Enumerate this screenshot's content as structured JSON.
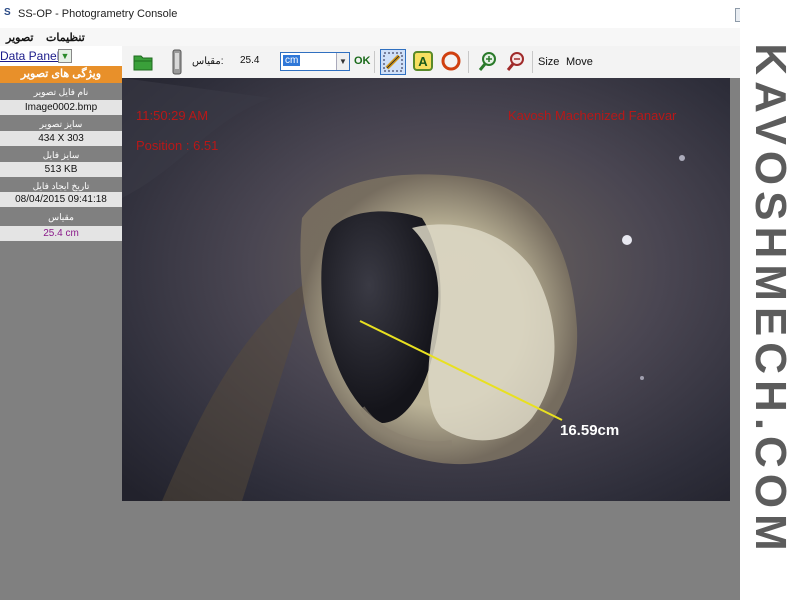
{
  "window": {
    "title": "SS-OP - Photogrametry Console",
    "icon": "ss-logo-icon",
    "controls": [
      "minimize-icon",
      "maximize-icon",
      "close-icon"
    ]
  },
  "menu": {
    "items": [
      "تصوير",
      "تنظيمات"
    ]
  },
  "toolbar": {
    "open_icon": "folder-icon",
    "device_icon": "camera-icon",
    "scale_label": "مقياس:",
    "scale_value": "25.4",
    "unit_value": "cm",
    "ok_label": "OK",
    "ruler_icon": "ruler-icon",
    "text_icon": "text-a-icon",
    "circle_icon": "circle-icon",
    "zoom_in_icon": "zoom-in-icon",
    "zoom_out_icon": "zoom-out-icon",
    "size_label": "Size",
    "move_label": "Move"
  },
  "sidebar": {
    "panel_label": "Data Panel",
    "panel_icon": "arrow-down-icon",
    "section_title": "ويژگی های تصوير",
    "properties": [
      {
        "label": "نام فايل تصوير",
        "value": "Image0002.bmp"
      },
      {
        "label": "سايز تصوير",
        "value": "434 X 303"
      },
      {
        "label": "سايز فايل",
        "value": "513 KB"
      },
      {
        "label": "تاريخ ايجاد فايل",
        "value": "08/04/2015 09:41:18"
      },
      {
        "label": "مقياس",
        "value": "25.4 cm"
      }
    ],
    "scale_value_color": "#8a1a8a"
  },
  "image": {
    "time_overlay": "11:50:29 AM",
    "position_overlay": "Position : 6.51",
    "company_overlay": "Kavosh Machenized Fanavar",
    "measurement": "16.59cm",
    "overlay_color": "#b81818",
    "measure_line_color": "#e8e020"
  },
  "watermark": "KAVOSHMECH.COM"
}
